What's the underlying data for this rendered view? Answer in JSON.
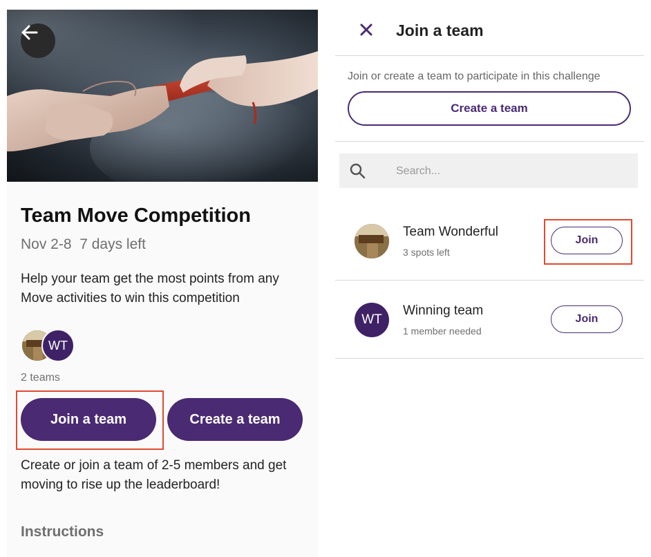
{
  "left": {
    "back_icon": "arrow-left-icon",
    "title": "Team Move Competition",
    "subtitle": "Nov 2-8  7 days left",
    "description": "Help your team get the most points from any Move activities to win this competition",
    "avatar_initials": "WT",
    "teams_count": "2 teams",
    "join_button": "Join a team",
    "create_button": "Create a team",
    "note": "Create or join a team of 2-5 members and get moving to rise up the leaderboard!",
    "instructions": "Instructions"
  },
  "right": {
    "close_icon": "close-icon",
    "title": "Join a team",
    "subtitle": "Join or create a team to participate in this challenge",
    "create_button": "Create a team",
    "search_placeholder": "Search...",
    "teams": [
      {
        "name": "Team Wonderful",
        "meta": "3 spots left",
        "action": "Join"
      },
      {
        "name": "Winning team",
        "initials": "WT",
        "meta": "1 member needed",
        "action": "Join"
      }
    ]
  },
  "colors": {
    "primary": "#4a2a72",
    "avatar": "#3f2266",
    "highlight": "#e04a2f"
  }
}
